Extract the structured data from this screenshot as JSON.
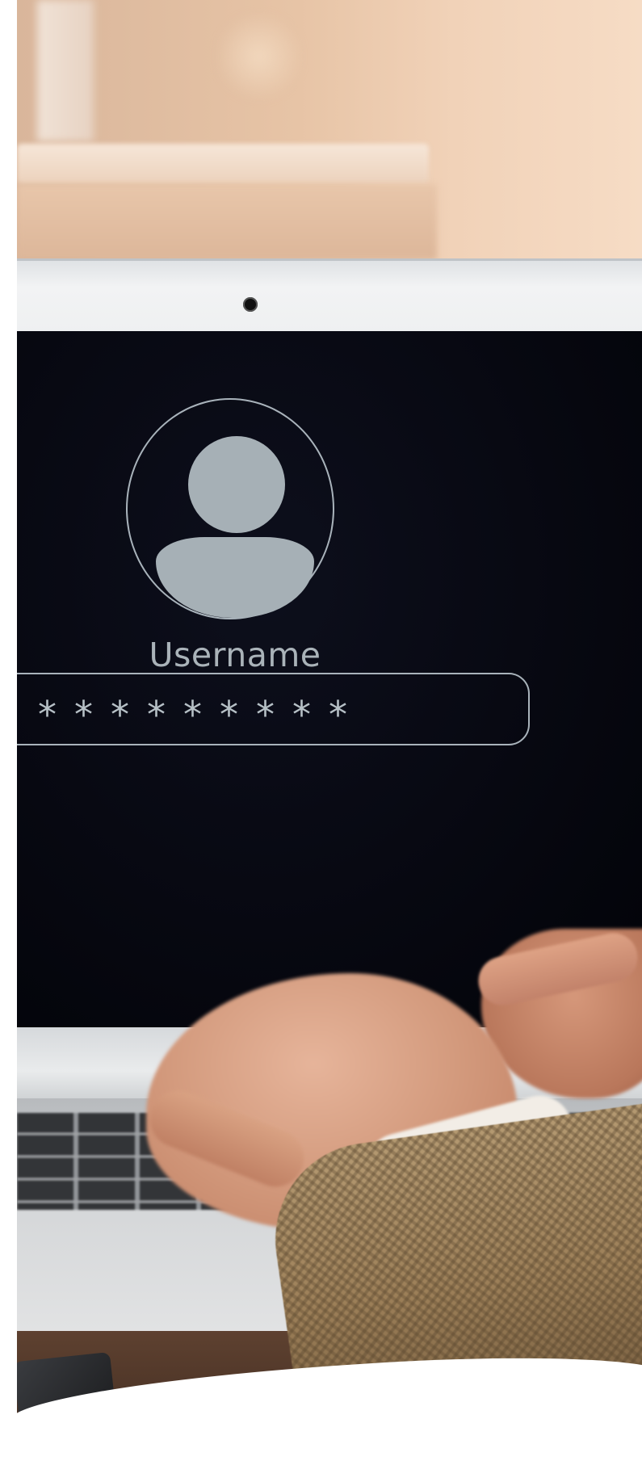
{
  "login_screen": {
    "username_label": "Username",
    "password_mask": "*********"
  },
  "scene": {
    "description_colors": {
      "screen_background": "#05060d",
      "avatar_fill": "#a6b0b6",
      "outline": "#a9b3bb"
    },
    "icons": [
      "user-avatar-icon",
      "webcam-icon"
    ]
  }
}
